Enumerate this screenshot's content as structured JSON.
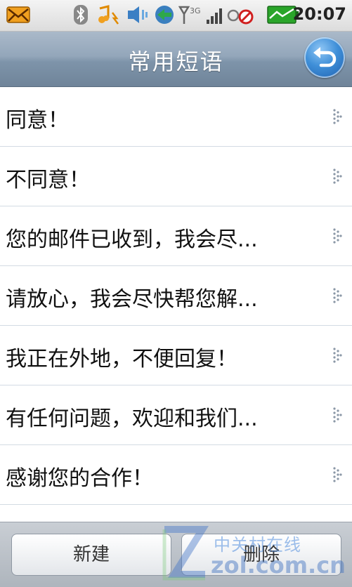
{
  "status_bar": {
    "time": "20:07",
    "icons": [
      "mail-icon",
      "bluetooth-icon",
      "music-icon",
      "speaker-icon",
      "sync-icon",
      "signal-3g-icon",
      "alarm-off-icon",
      "battery-icon"
    ]
  },
  "header": {
    "title": "常用短语",
    "back_icon": "back-arrow-icon"
  },
  "phrases": [
    "同意！",
    "不同意！",
    "您的邮件已收到，我会尽...",
    "请放心，我会尽快帮您解...",
    "我正在外地，不便回复！",
    "有任何问题，欢迎和我们...",
    "感谢您的合作！"
  ],
  "toolbar": {
    "new_label": "新建",
    "delete_label": "删除"
  },
  "watermark": {
    "text_cn": "中关村在线",
    "text_url": "zol.com.cn"
  },
  "colors": {
    "title_bar": "#8ea2b7",
    "accent_blue": "#3f8fd8",
    "battery_green": "#2aa52a"
  }
}
